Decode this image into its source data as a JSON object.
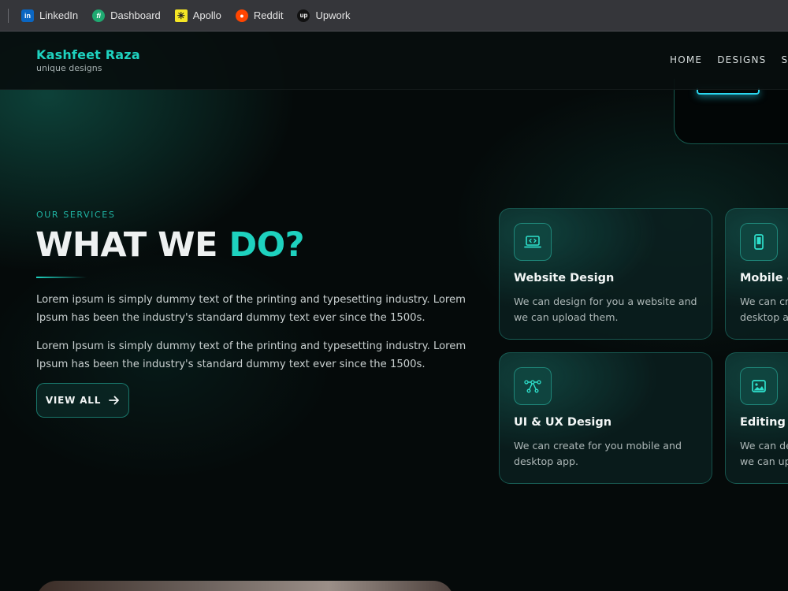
{
  "bookmarks": [
    {
      "label": "LinkedIn",
      "icon": "linkedin-icon",
      "glyph": "in"
    },
    {
      "label": "Dashboard",
      "icon": "dashboard-icon",
      "glyph": "fi"
    },
    {
      "label": "Apollo",
      "icon": "apollo-icon",
      "glyph": "✳"
    },
    {
      "label": "Reddit",
      "icon": "reddit-icon",
      "glyph": "●"
    },
    {
      "label": "Upwork",
      "icon": "upwork-icon",
      "glyph": "up"
    }
  ],
  "header": {
    "brand_name": "Kashfeet Raza",
    "brand_tagline": "unique designs",
    "nav": [
      "HOME",
      "DESIGNS",
      "SE"
    ]
  },
  "services": {
    "eyebrow": "OUR SERVICES",
    "heading_main": "WHAT WE ",
    "heading_accent": "DO?",
    "paragraphs": [
      "Lorem ipsum is simply dummy text of the printing and typesetting industry. Lorem Ipsum has been the industry's standard dummy text ever since the 1500s.",
      "Lorem Ipsum is simply dummy text of the printing and typesetting industry. Lorem Ipsum has been the industry's standard dummy text ever since the 1500s."
    ],
    "button_label": "VIEW ALL",
    "cards": [
      {
        "title": "Website Design",
        "description": "We can design for you a website and\nwe can upload them.",
        "icon": "laptop-code-icon"
      },
      {
        "title": "Mobile &",
        "description": "We can cr\ndesktop a",
        "icon": "mobile-icon"
      },
      {
        "title": "UI & UX Design",
        "description": "We can create for you mobile and\ndesktop app.",
        "icon": "vector-pen-icon"
      },
      {
        "title": "Editing F",
        "description": "We can de\nwe can up",
        "icon": "image-icon"
      }
    ]
  },
  "colors": {
    "accent": "#1ed2bf",
    "background": "#050a0a",
    "bookmark_bar": "#35363a"
  }
}
